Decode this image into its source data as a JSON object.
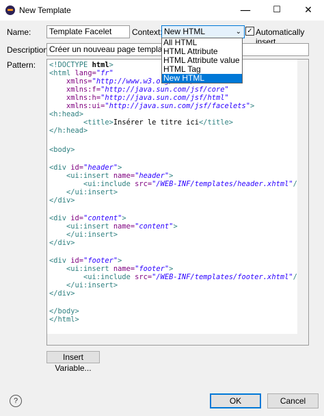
{
  "window": {
    "title": "New Template",
    "minimize": "—",
    "maximize": "☐",
    "close": "✕"
  },
  "form": {
    "name_label": "Name:",
    "name_value": "Template Facelet",
    "context_label": "Context:",
    "context_value": "New HTML",
    "auto_insert_label": "Automatically insert",
    "auto_insert_checked": "✓",
    "description_label": "Description:",
    "description_value": "Créer un nouveau page template",
    "pattern_label": "Pattern:"
  },
  "context_options": [
    "All HTML",
    "HTML Attribute",
    "HTML Attribute value",
    "HTML Tag",
    "New HTML"
  ],
  "code": {
    "l1a": "<!DOCTYPE ",
    "l1b": "html",
    "l1c": ">",
    "l2a": "<html ",
    "l2b": "lang=",
    "l2c": "\"fr\"",
    "l3a": "    xmlns=",
    "l3b": "\"http://www.w3.org/1999/xhtml\"",
    "l4a": "    xmlns:f=",
    "l4b": "\"http://java.sun.com/jsf/core\"",
    "l5a": "    xmlns:h=",
    "l5b": "\"http://java.sun.com/jsf/html\"",
    "l6a": "    xmlns:ui=",
    "l6b": "\"http://java.sun.com/jsf/facelets\"",
    "l6c": ">",
    "l7": "<h:head>",
    "l8a": "        <title>",
    "l8b": "Insérer le titre ici",
    "l8c": "</title>",
    "l9": "</h:head>",
    "l10": "<body>",
    "l11a": "<div ",
    "l11b": "id=",
    "l11c": "\"header\"",
    "l11d": ">",
    "l12a": "    <ui:insert ",
    "l12b": "name=",
    "l12c": "\"header\"",
    "l12d": ">",
    "l13a": "        <ui:include ",
    "l13b": "src=",
    "l13c": "\"/WEB-INF/templates/header.xhtml\"",
    "l13d": "/>",
    "l14": "    </ui:insert>",
    "l15": "</div>",
    "l16a": "<div ",
    "l16b": "id=",
    "l16c": "\"content\"",
    "l16d": ">",
    "l17a": "    <ui:insert ",
    "l17b": "name=",
    "l17c": "\"content\"",
    "l17d": ">",
    "l18": "    </ui:insert>",
    "l19": "</div>",
    "l20a": "<div ",
    "l20b": "id=",
    "l20c": "\"footer\"",
    "l20d": ">",
    "l21a": "    <ui:insert ",
    "l21b": "name=",
    "l21c": "\"footer\"",
    "l21d": ">",
    "l22a": "        <ui:include ",
    "l22b": "src=",
    "l22c": "\"/WEB-INF/templates/footer.xhtml\"",
    "l22d": "/>",
    "l23": "    </ui:insert>",
    "l24": "</div>",
    "l25": "</body>",
    "l26": "</html>"
  },
  "buttons": {
    "insert_variable": "Insert Variable...",
    "ok": "OK",
    "cancel": "Cancel",
    "help": "?"
  }
}
